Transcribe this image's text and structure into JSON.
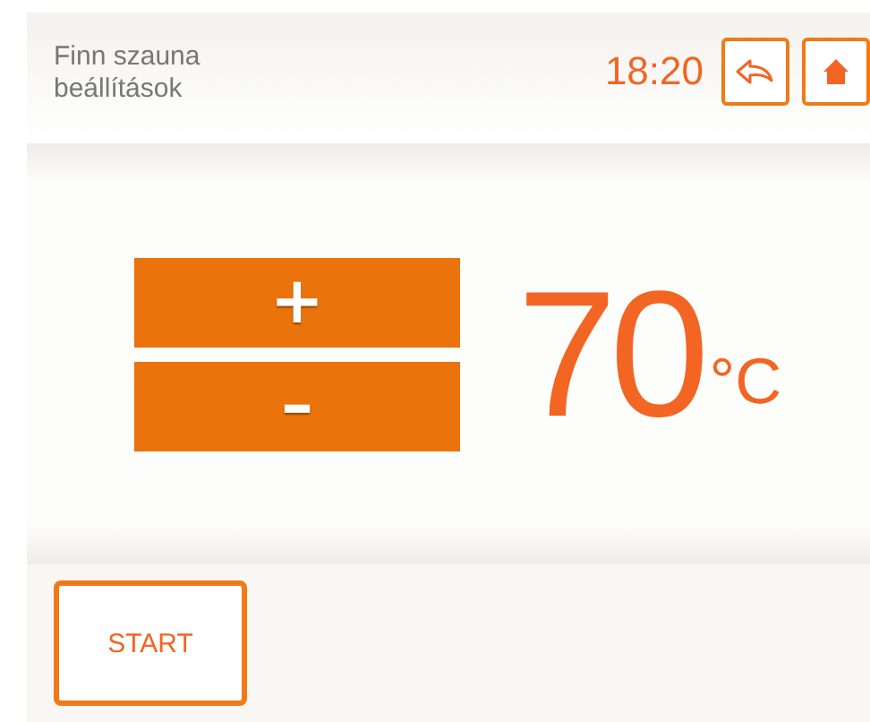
{
  "header": {
    "title_lines": [
      "Finn szauna",
      "beállítások"
    ],
    "time": "18:20"
  },
  "temperature": {
    "increase_label": "+",
    "decrease_label": "–",
    "value": "70",
    "unit": "°C"
  },
  "footer": {
    "start_label": "START"
  }
}
